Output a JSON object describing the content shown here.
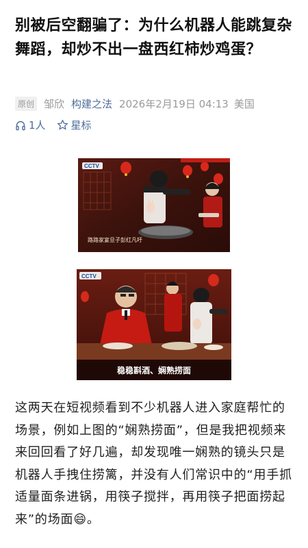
{
  "article": {
    "title": "别被后空翻骗了：为什么机器人能跳复杂舞蹈，却炒不出一盘西红柿炒鸡蛋？",
    "badge": "原创",
    "author": "邹欣",
    "account": "构建之法",
    "date": "2026年2月19日 04:13",
    "location": "美国",
    "listen_count": "1人",
    "star_label": "星标",
    "images": [
      {
        "icon": "cctv-logo",
        "caption": "路路家宴旦子彭红凡吁"
      },
      {
        "icon": "cctv-logo",
        "caption": "稳稳斟酒、娴熟捞面"
      }
    ],
    "body": "这两天在短视频看到不少机器人进入家庭帮忙的场景，例如上图的“娴熟捞面”，但是我把视频来来回回看了好几遍，却发现唯一娴熟的镜头只是机器人手拽住捞篱，并没有人们常识中的“用手抓适量面条进锅，用筷子搅拌，再用筷子把面捞起来”的场面",
    "emoji": "😄",
    "body_end": "。"
  },
  "colors": {
    "link": "#4d6d9a",
    "meta": "#9a9a9a",
    "title": "#111111"
  }
}
